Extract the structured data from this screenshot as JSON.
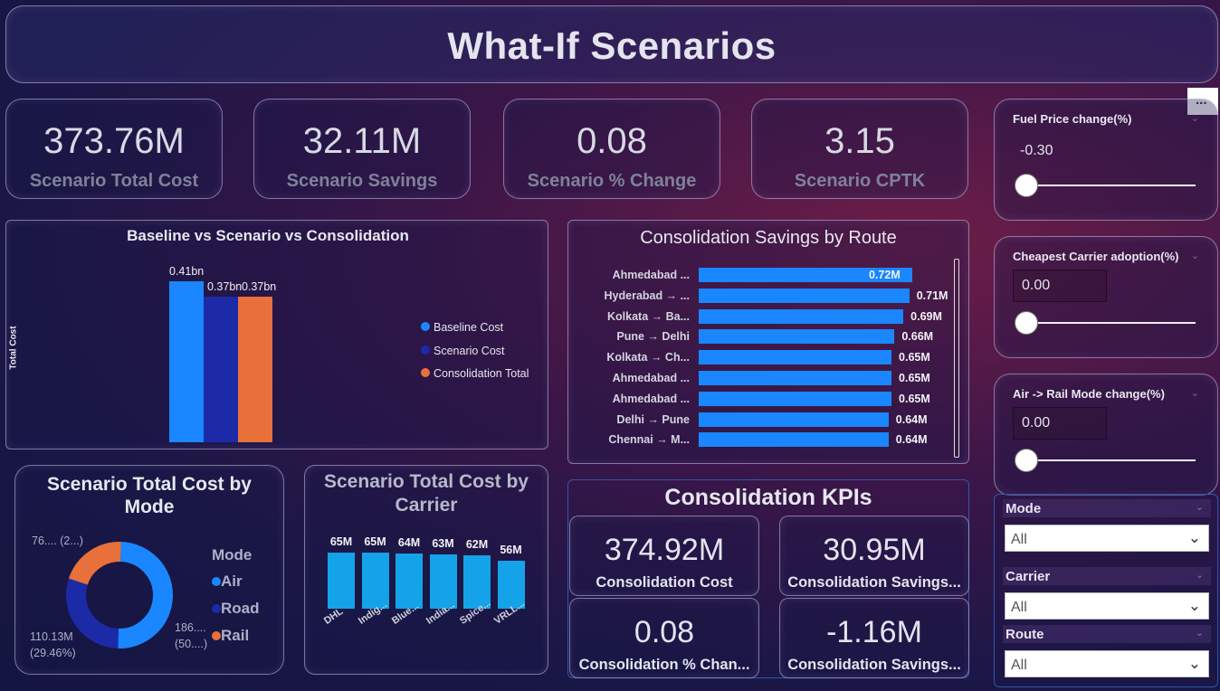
{
  "page_title": "What-If Scenarios",
  "more_options": "...",
  "kpis": [
    {
      "value": "373.76M",
      "label": "Scenario Total Cost"
    },
    {
      "value": "32.11M",
      "label": "Scenario Savings"
    },
    {
      "value": "0.08",
      "label": "Scenario % Change"
    },
    {
      "value": "3.15",
      "label": "Scenario CPTK"
    }
  ],
  "sliders": [
    {
      "title": "Fuel Price change(%)",
      "value": "-0.30",
      "level": 0
    },
    {
      "title": "Cheapest Carrier adoption(%)",
      "value": "0.00",
      "level": 0
    },
    {
      "title": "Air -> Rail Mode change(%)",
      "value": "0.00",
      "level": 0
    }
  ],
  "filters": [
    {
      "label": "Mode",
      "value": "All"
    },
    {
      "label": "Carrier",
      "value": "All"
    },
    {
      "label": "Route",
      "value": "All"
    }
  ],
  "consolidation_kpis": {
    "title": "Consolidation KPIs",
    "items": [
      {
        "value": "374.92M",
        "label": "Consolidation Cost"
      },
      {
        "value": "30.95M",
        "label": "Consolidation Savings..."
      },
      {
        "value": "0.08",
        "label": "Consolidation % Chan..."
      },
      {
        "value": "-1.16M",
        "label": "Consolidation Savings..."
      }
    ]
  },
  "colors": {
    "baseline": "#1a86ff",
    "scenario": "#1c2aa8",
    "consolidation": "#e8703a",
    "air": "#1a86ff",
    "road": "#1c2aa8",
    "rail": "#e8703a",
    "carrier_bar": "#14a3e8"
  },
  "chart_data": [
    {
      "type": "bar",
      "title": "Baseline vs Scenario vs Consolidation",
      "ylabel": "Total Cost",
      "series": [
        {
          "name": "Baseline Cost",
          "values": [
            0.41
          ],
          "label": "0.41bn"
        },
        {
          "name": "Scenario  Cost",
          "values": [
            0.37
          ],
          "label": "0.37bn"
        },
        {
          "name": "Consolidation Total",
          "values": [
            0.37
          ],
          "label": "0.37bn"
        }
      ],
      "unit": "bn",
      "ylim": [
        0,
        0.41
      ],
      "legend": "right"
    },
    {
      "type": "bar",
      "orientation": "horizontal",
      "title": "Consolidation Savings by Route",
      "categories": [
        "Ahmedabad ...",
        "Hyderabad → ...",
        "Kolkata → Ba...",
        "Pune → Delhi",
        "Kolkata → Ch...",
        "Ahmedabad ...",
        "Ahmedabad ...",
        "Delhi → Pune",
        "Chennai → M..."
      ],
      "values": [
        0.72,
        0.71,
        0.69,
        0.66,
        0.65,
        0.65,
        0.65,
        0.64,
        0.64
      ],
      "labels": [
        "0.72M",
        "0.71M",
        "0.69M",
        "0.66M",
        "0.65M",
        "0.65M",
        "0.65M",
        "0.64M",
        "0.64M"
      ],
      "unit": "M"
    },
    {
      "type": "pie",
      "title": "Scenario Total Cost by Mode",
      "legend_title": "Mode",
      "categories": [
        "Air",
        "Road",
        "Rail"
      ],
      "values": [
        186,
        110.13,
        76
      ],
      "labels": [
        "186....\n(50....)",
        "110.13M\n(29.46%)",
        "76.... (2...)"
      ],
      "legend": "right"
    },
    {
      "type": "bar",
      "title": "Scenario Total Cost by Carrier",
      "categories": [
        "DHL",
        "Indig...",
        "Blue...",
        "India...",
        "Spice...",
        "VRLL..."
      ],
      "values": [
        65,
        65,
        64,
        63,
        62,
        56
      ],
      "labels": [
        "65M",
        "65M",
        "64M",
        "63M",
        "62M",
        "56M"
      ],
      "unit": "M"
    }
  ]
}
